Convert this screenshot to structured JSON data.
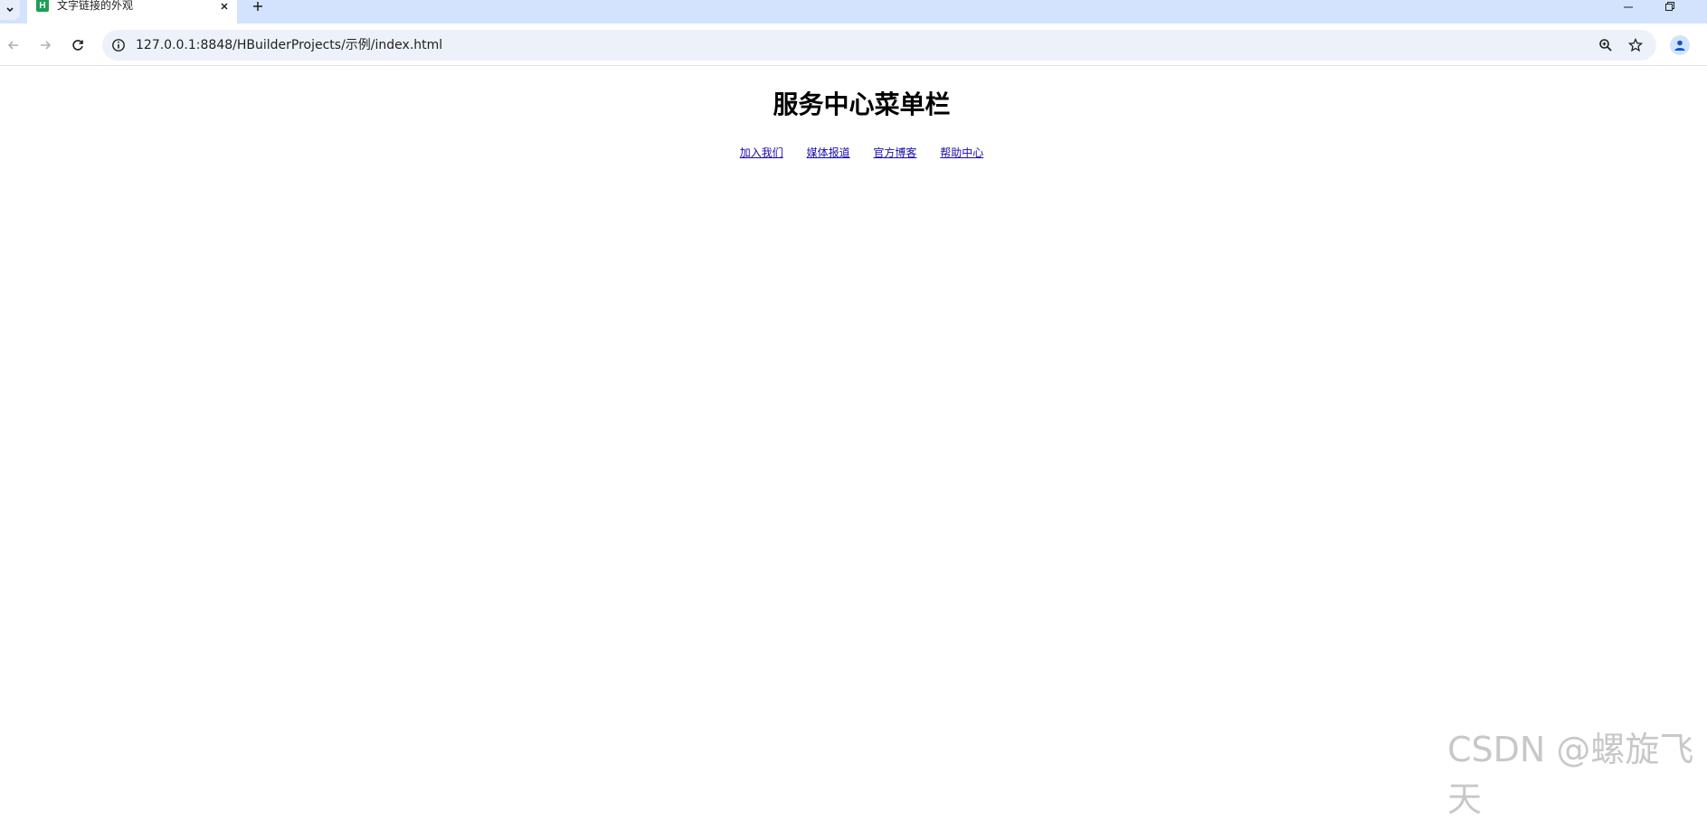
{
  "tab": {
    "title": "文字链接的外观",
    "favicon_letter": "H"
  },
  "toolbar": {
    "url": "127.0.0.1:8848/HBuilderProjects/示例/index.html"
  },
  "page": {
    "title": "服务中心菜单栏",
    "menu": [
      {
        "label": "加入我们"
      },
      {
        "label": "媒体报道"
      },
      {
        "label": "官方博客"
      },
      {
        "label": "帮助中心"
      }
    ]
  },
  "watermark": "CSDN @螺旋飞天",
  "icons": {
    "tab_list": "chevron-down-icon",
    "close": "close-icon",
    "new_tab": "plus-icon",
    "back": "arrow-left-icon",
    "forward": "arrow-right-icon",
    "reload": "reload-icon",
    "site_info": "info-icon",
    "zoom": "zoom-icon",
    "bookmark": "star-icon",
    "profile": "person-icon",
    "minimize": "minimize-icon",
    "restore": "restore-icon"
  },
  "colors": {
    "tabstrip": "#d3e3fd",
    "omnibox": "#edf2fa",
    "link": "#1a0dab",
    "favicon": "#1f9e56"
  }
}
